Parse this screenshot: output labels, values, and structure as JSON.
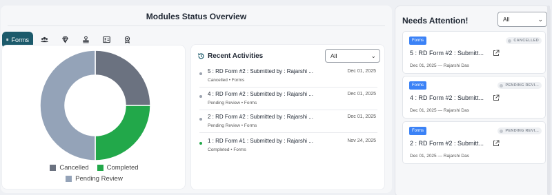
{
  "overview": {
    "title": "Modules Status Overview",
    "tabs": [
      {
        "label": "Forms",
        "icon": "document-icon",
        "active": true
      },
      {
        "label": "",
        "icon": "users-icon"
      },
      {
        "label": "",
        "icon": "diamond-icon"
      },
      {
        "label": "",
        "icon": "stamp-icon"
      },
      {
        "label": "",
        "icon": "id-card-icon"
      },
      {
        "label": "",
        "icon": "award-icon"
      }
    ]
  },
  "chart_data": {
    "type": "pie",
    "categories": [
      "Cancelled",
      "Completed",
      "Pending Review"
    ],
    "values": [
      1,
      1,
      2
    ],
    "colors": [
      "#6b7280",
      "#22a84a",
      "#94a3b8"
    ],
    "legend_position": "bottom"
  },
  "recent": {
    "title": "Recent Activities",
    "filter": "All",
    "items": [
      {
        "title": "5 : RD Form #2 : Submitted by : Rajarshi ...",
        "date": "Dec 01, 2025",
        "sub": "Cancelled • Forms",
        "dot": "#9ca3af"
      },
      {
        "title": "4 : RD Form #2 : Submitted by : Rajarshi ...",
        "date": "Dec 01, 2025",
        "sub": "Pending Review • Forms",
        "dot": "#9ca3af"
      },
      {
        "title": "2 : RD Form #2 : Submitted by : Rajarshi ...",
        "date": "Dec 01, 2025",
        "sub": "Pending Review • Forms",
        "dot": "#9ca3af"
      },
      {
        "title": "1 : RD Form #1 : Submitted by : Rajarshi ...",
        "date": "Nov 24, 2025",
        "sub": "Completed • Forms",
        "dot": "#22a84a"
      }
    ]
  },
  "attention": {
    "title": "Needs Attention!",
    "filter": "All",
    "cards": [
      {
        "badge": "Forms",
        "status": "CANCELLED",
        "title": "5 : RD Form #2 : Submitt...",
        "sub": "Dec 01, 2025 — Rajarshi Das"
      },
      {
        "badge": "Forms",
        "status": "PENDING REVI...",
        "title": "4 : RD Form #2 : Submitt...",
        "sub": "Dec 01, 2025 — Rajarshi Das"
      },
      {
        "badge": "Forms",
        "status": "PENDING REVI...",
        "title": "2 : RD Form #2 : Submitt...",
        "sub": "Dec 01, 2025 — Rajarshi Das"
      }
    ]
  }
}
